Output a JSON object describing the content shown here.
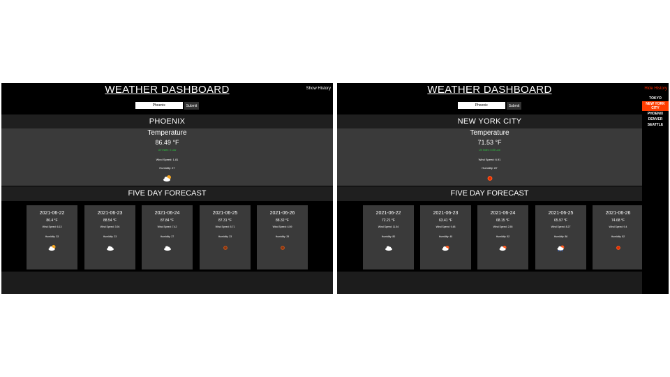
{
  "left": {
    "title": "WEATHER DASHBOARD",
    "history_toggle": "Show History",
    "search": {
      "value": "Phoenix",
      "submit": "Submit"
    },
    "city": "PHOENIX",
    "current": {
      "label": "Temperature",
      "temp": "86.49 °F",
      "uv": "UV Index: 0 Low",
      "wind": "Wind Speed: 1.81",
      "humidity": "Humidity: 27",
      "icon": "few-clouds-day-icon"
    },
    "forecast_title": "FIVE DAY FORECAST",
    "forecast": [
      {
        "date": "2021-06-22",
        "temp": "86.4 °F",
        "wind": "Wind Speed: 6.13",
        "humidity": "Humidity: 33",
        "icon": "few-clouds-day-icon"
      },
      {
        "date": "2021-06-23",
        "temp": "88.54 °F",
        "wind": "Wind Speed: 3.94",
        "humidity": "Humidity: 23",
        "icon": "cloud-icon"
      },
      {
        "date": "2021-06-24",
        "temp": "87.84 °F",
        "wind": "Wind Speed: 7.42",
        "humidity": "Humidity: 27",
        "icon": "cloud-icon"
      },
      {
        "date": "2021-06-25",
        "temp": "87.31 °F",
        "wind": "Wind Speed: 5.71",
        "humidity": "Humidity: 23",
        "icon": "clear-sky-icon"
      },
      {
        "date": "2021-06-26",
        "temp": "88.32 °F",
        "wind": "Wind Speed: 4.59",
        "humidity": "Humidity: 29",
        "icon": "clear-sky-icon"
      }
    ]
  },
  "right": {
    "title": "WEATHER DASHBOARD",
    "history_toggle": "Hide History",
    "search": {
      "value": "Phoenix",
      "submit": "Submit"
    },
    "city": "NEW YORK CITY",
    "current": {
      "label": "Temperature",
      "temp": "71.53 °F",
      "uv": "UV Index: 0.09 Low",
      "wind": "Wind Speed: 6.91",
      "humidity": "Humidity: 87",
      "icon": "clear-sky-icon"
    },
    "forecast_title": "FIVE DAY FORECAST",
    "forecast": [
      {
        "date": "2021-06-22",
        "temp": "72.21 °F",
        "wind": "Wind Speed: 11.54",
        "humidity": "Humidity: 80",
        "icon": "cloud-icon"
      },
      {
        "date": "2021-06-23",
        "temp": "63.41 °F",
        "wind": "Wind Speed: 9.48",
        "humidity": "Humidity: 40",
        "icon": "few-clouds-day-icon"
      },
      {
        "date": "2021-06-24",
        "temp": "68.15 °F",
        "wind": "Wind Speed: 2.55",
        "humidity": "Humidity: 52",
        "icon": "few-clouds-day-icon"
      },
      {
        "date": "2021-06-25",
        "temp": "65.97 °F",
        "wind": "Wind Speed: 8.27",
        "humidity": "Humidity: 86",
        "icon": "rain-day-icon"
      },
      {
        "date": "2021-06-26",
        "temp": "74.68 °F",
        "wind": "Wind Speed: 9.4",
        "humidity": "Humidity: 82",
        "icon": "clear-sky-icon"
      }
    ],
    "history": [
      "TOKYO",
      "NEW YORK CITY",
      "PHOENIX",
      "DENVER",
      "SEATTLE"
    ],
    "history_active_index": 1
  },
  "colors": {
    "panel_bg": "#000000",
    "card_bg": "#3a3a3a",
    "bar_bg": "#1f1f1f",
    "accent": "#ff3d00",
    "uv_green": "#2ecc40"
  }
}
